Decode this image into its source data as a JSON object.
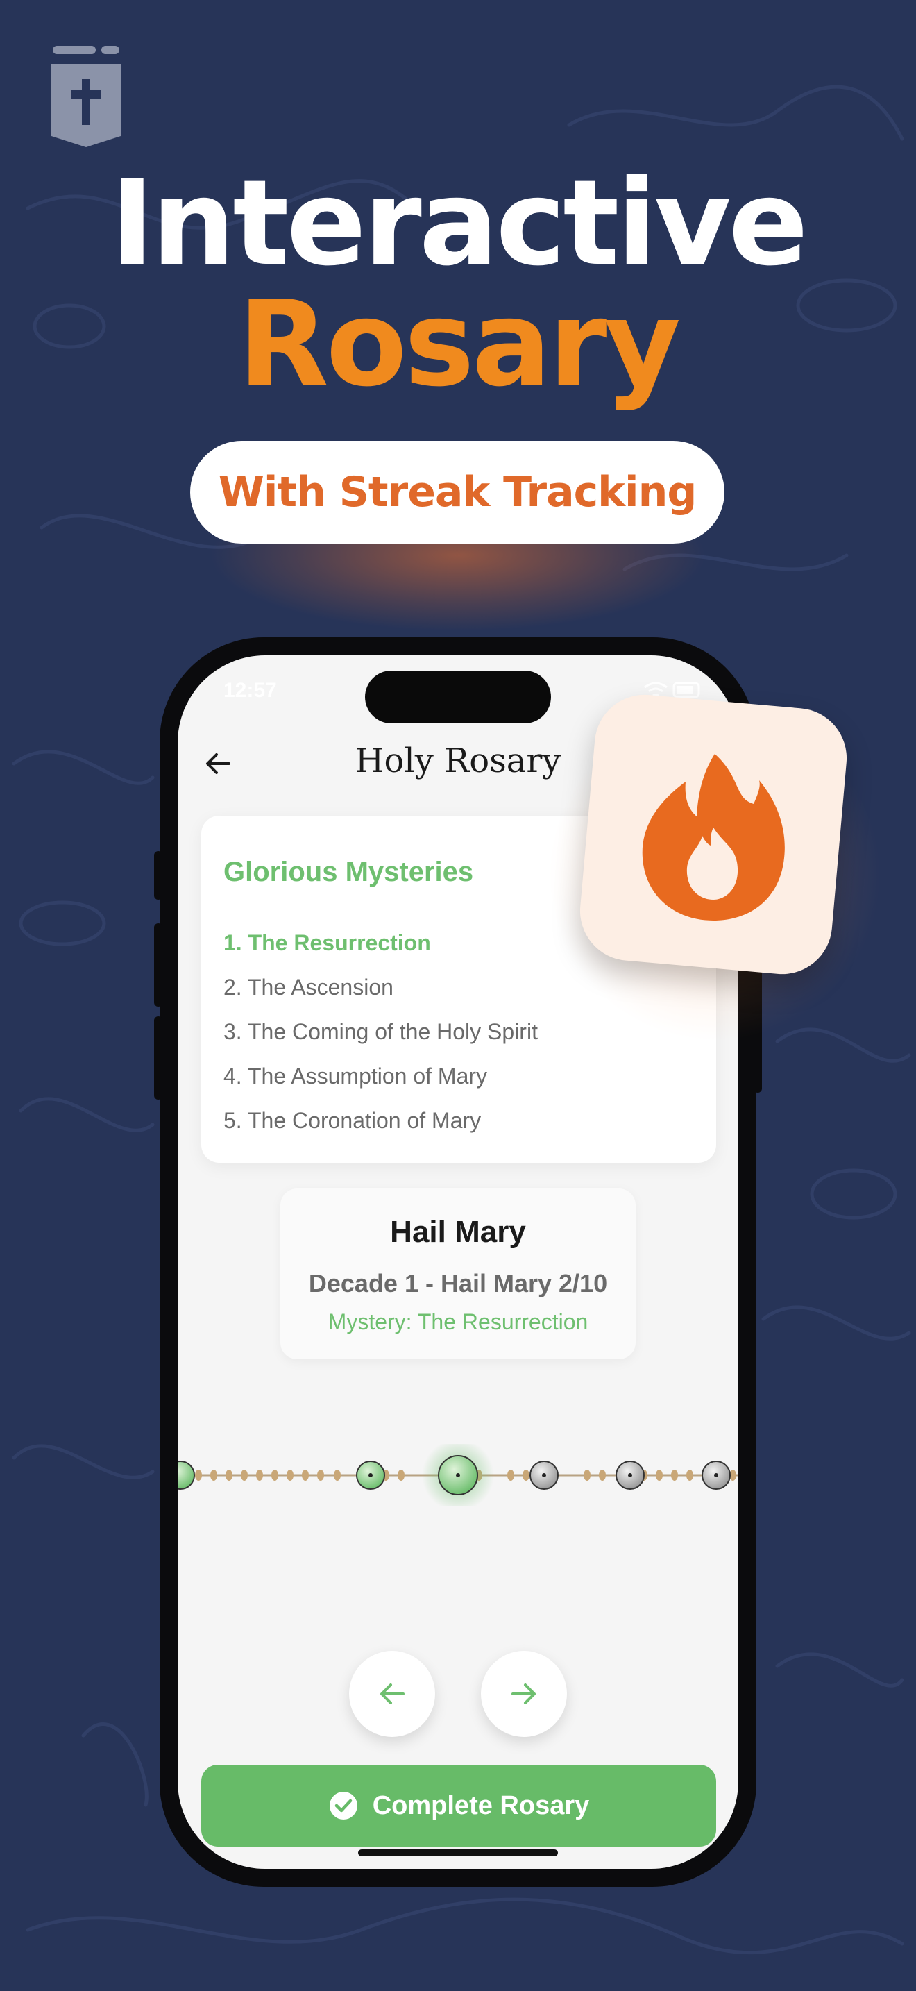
{
  "colors": {
    "background": "#273458",
    "accent_orange": "#f08a1e",
    "green": "#6ebf6f",
    "button_green": "#67bb68",
    "flame": "#e86a1f"
  },
  "hero": {
    "line1": "Interactive",
    "line2": "Rosary",
    "pill_text": "With Streak Tracking"
  },
  "status_bar": {
    "time": "12:57"
  },
  "header": {
    "title": "Holy Rosary",
    "back_icon": "arrow-left-icon"
  },
  "mysteries": {
    "title": "Glorious Mysteries",
    "items": [
      "1. The Resurrection",
      "2. The Ascension",
      "3. The Coming of the Holy Spirit",
      "4. The Assumption of Mary",
      "5. The Coronation of Mary"
    ],
    "active_index": 0
  },
  "prayer": {
    "title": "Hail Mary",
    "progress": "Decade 1 - Hail Mary 2/10",
    "mystery": "Mystery: The Resurrection"
  },
  "badge": {
    "icon": "flame-icon"
  },
  "controls": {
    "prev_icon": "arrow-left-icon",
    "next_icon": "arrow-right-icon",
    "complete_label": "Complete Rosary",
    "complete_icon": "check-circle-icon"
  }
}
